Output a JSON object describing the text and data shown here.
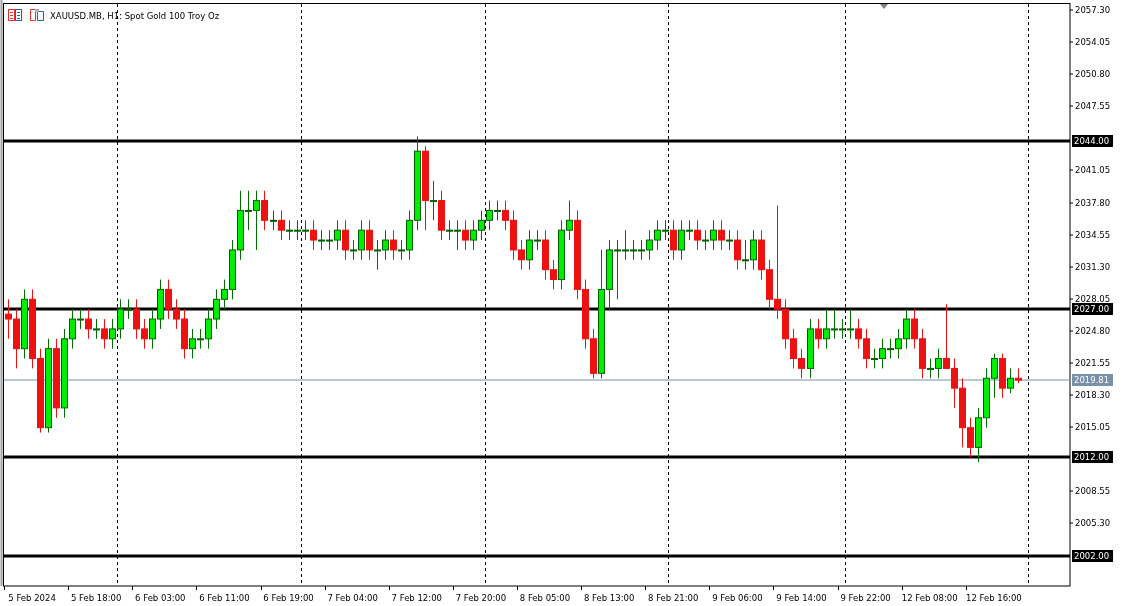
{
  "chart_title": {
    "symbol": "XAUUSD.MB, H1:",
    "description": "Spot Gold 100 Troy Oz"
  },
  "chart_data": {
    "type": "candlestick",
    "ylim": [
      1998.96,
      2057.91
    ],
    "categories": [
      null,
      null,
      null,
      "5 Feb 2024",
      null,
      null,
      null,
      null,
      null,
      null,
      null,
      "5 Feb 18:00",
      null,
      null,
      null,
      null,
      null,
      null,
      null,
      "6 Feb 03:00",
      null,
      null,
      null,
      null,
      null,
      null,
      null,
      "6 Feb 11:00",
      null,
      null,
      null,
      null,
      null,
      null,
      null,
      "6 Feb 19:00",
      null,
      null,
      null,
      null,
      null,
      null,
      null,
      "7 Feb 04:00",
      null,
      null,
      null,
      null,
      null,
      null,
      null,
      "7 Feb 12:00",
      null,
      null,
      null,
      null,
      null,
      null,
      null,
      "7 Feb 20:00",
      null,
      null,
      null,
      null,
      null,
      null,
      null,
      "8 Feb 05:00",
      null,
      null,
      null,
      null,
      null,
      null,
      null,
      "8 Feb 13:00",
      null,
      null,
      null,
      null,
      null,
      null,
      null,
      "8 Feb 21:00",
      null,
      null,
      null,
      null,
      null,
      null,
      null,
      "9 Feb 06:00",
      null,
      null,
      null,
      null,
      null,
      null,
      null,
      "9 Feb 14:00",
      null,
      null,
      null,
      null,
      null,
      null,
      null,
      "9 Feb 22:00",
      null,
      null,
      null,
      null,
      null,
      null,
      null,
      "12 Feb 08:00",
      null,
      null,
      null,
      null,
      null,
      null,
      null,
      "12 Feb 16:00",
      null,
      null,
      null,
      null,
      null,
      null,
      null,
      null,
      null
    ],
    "yticks": [
      {
        "value": 2057.3,
        "label": "2057.30"
      },
      {
        "value": 2054.05,
        "label": "2054.05"
      },
      {
        "value": 2050.8,
        "label": "2050.80"
      },
      {
        "value": 2047.55,
        "label": "2047.55"
      },
      {
        "value": 2041.05,
        "label": "2041.05"
      },
      {
        "value": 2037.8,
        "label": "2037.80"
      },
      {
        "value": 2034.55,
        "label": "2034.55"
      },
      {
        "value": 2031.3,
        "label": "2031.30"
      },
      {
        "value": 2028.05,
        "label": "2028.05"
      },
      {
        "value": 2024.8,
        "label": "2024.80"
      },
      {
        "value": 2021.55,
        "label": "2021.55"
      },
      {
        "value": 2018.3,
        "label": "2018.30"
      },
      {
        "value": 2015.05,
        "label": "2015.05"
      },
      {
        "value": 2008.55,
        "label": "2008.55"
      },
      {
        "value": 2005.3,
        "label": "2005.30"
      }
    ],
    "ref_lines": [
      {
        "axis": "y",
        "value": 2044.0,
        "label": "2044.00",
        "color": "#000000"
      },
      {
        "axis": "y",
        "value": 2027.0,
        "label": "2027.00",
        "color": "#000000"
      },
      {
        "axis": "y",
        "value": 2019.81,
        "label": "2019.81",
        "color": "#7890a8"
      },
      {
        "axis": "y",
        "value": 2012.0,
        "label": "2012.00",
        "color": "#000000"
      },
      {
        "axis": "y",
        "value": 2002.0,
        "label": "2002.00",
        "color": "#000000"
      }
    ],
    "ohlc": [
      [
        2026.5,
        2028,
        2024,
        2026
      ],
      [
        2026,
        2027,
        2021,
        2023
      ],
      [
        2023,
        2029,
        2022,
        2028
      ],
      [
        2028,
        2029,
        2021,
        2022
      ],
      [
        2022,
        2023,
        2014.5,
        2015
      ],
      [
        2015,
        2024,
        2014.5,
        2023
      ],
      [
        2023,
        2024,
        2016,
        2017
      ],
      [
        2017,
        2025,
        2016,
        2024
      ],
      [
        2024,
        2027,
        2023,
        2026
      ],
      [
        2026,
        2027,
        2025,
        2026
      ],
      [
        2026,
        2027,
        2024,
        2025
      ],
      [
        2025,
        2026,
        2024,
        2025
      ],
      [
        2025,
        2026,
        2023,
        2024
      ],
      [
        2024,
        2026,
        2023,
        2025
      ],
      [
        2025,
        2028,
        2024,
        2027
      ],
      [
        2027,
        2028,
        2026,
        2027
      ],
      [
        2027,
        2028,
        2024,
        2025
      ],
      [
        2025,
        2026,
        2023,
        2024
      ],
      [
        2024,
        2027,
        2023,
        2026
      ],
      [
        2026,
        2030,
        2025,
        2029
      ],
      [
        2029,
        2030,
        2026,
        2027
      ],
      [
        2027,
        2028,
        2025,
        2026
      ],
      [
        2026,
        2027,
        2022,
        2023
      ],
      [
        2023,
        2025,
        2022,
        2024
      ],
      [
        2024,
        2025,
        2023,
        2024
      ],
      [
        2024,
        2027,
        2023,
        2026
      ],
      [
        2026,
        2029,
        2025,
        2028
      ],
      [
        2028,
        2030,
        2027,
        2029
      ],
      [
        2029,
        2034,
        2028,
        2033
      ],
      [
        2033,
        2039,
        2032,
        2037
      ],
      [
        2037,
        2039,
        2035,
        2037
      ],
      [
        2037,
        2039,
        2033,
        2038
      ],
      [
        2038,
        2039,
        2035,
        2036
      ],
      [
        2036,
        2037,
        2035,
        2036
      ],
      [
        2036,
        2037,
        2034,
        2035
      ],
      [
        2035,
        2036,
        2034,
        2035
      ],
      [
        2035,
        2036,
        2034,
        2035
      ],
      [
        2035,
        2036,
        2034,
        2035
      ],
      [
        2035,
        2036,
        2033,
        2034
      ],
      [
        2034,
        2035,
        2033,
        2034
      ],
      [
        2034,
        2035,
        2033,
        2034
      ],
      [
        2034,
        2036,
        2033,
        2035
      ],
      [
        2035,
        2036,
        2032,
        2033
      ],
      [
        2033,
        2034,
        2032,
        2033
      ],
      [
        2033,
        2036,
        2032,
        2035
      ],
      [
        2035,
        2036,
        2032,
        2033
      ],
      [
        2033,
        2034,
        2031,
        2033
      ],
      [
        2033,
        2035,
        2032,
        2034
      ],
      [
        2034,
        2035,
        2032,
        2033
      ],
      [
        2033,
        2034,
        2032,
        2033
      ],
      [
        2033,
        2037,
        2032,
        2036
      ],
      [
        2036,
        2044.5,
        2035,
        2043
      ],
      [
        2043,
        2043.5,
        2035,
        2038
      ],
      [
        2038,
        2040,
        2036,
        2038
      ],
      [
        2038,
        2039,
        2034,
        2035
      ],
      [
        2035,
        2036,
        2034,
        2035
      ],
      [
        2035,
        2036,
        2033,
        2035
      ],
      [
        2035,
        2036,
        2033,
        2034
      ],
      [
        2034,
        2036,
        2033,
        2035
      ],
      [
        2035,
        2037,
        2034,
        2036
      ],
      [
        2036,
        2038,
        2035,
        2037
      ],
      [
        2037,
        2038,
        2036,
        2037
      ],
      [
        2037,
        2038,
        2035,
        2036
      ],
      [
        2036,
        2037,
        2032,
        2033
      ],
      [
        2033,
        2034,
        2031,
        2032
      ],
      [
        2032,
        2035,
        2031,
        2034
      ],
      [
        2034,
        2035,
        2033,
        2034
      ],
      [
        2034,
        2035,
        2030,
        2031
      ],
      [
        2031,
        2032,
        2029,
        2030
      ],
      [
        2030,
        2036,
        2029,
        2035
      ],
      [
        2035,
        2038,
        2034,
        2036
      ],
      [
        2036,
        2037,
        2028,
        2029
      ],
      [
        2029,
        2030,
        2023,
        2024
      ],
      [
        2024,
        2025,
        2020,
        2020.5
      ],
      [
        2020.5,
        2033,
        2020,
        2029
      ],
      [
        2029,
        2034,
        2027,
        2033
      ],
      [
        2033,
        2034,
        2028,
        2033
      ],
      [
        2033,
        2035,
        2032,
        2033
      ],
      [
        2033,
        2034,
        2032,
        2033
      ],
      [
        2033,
        2034,
        2032,
        2033
      ],
      [
        2033,
        2035,
        2032,
        2034
      ],
      [
        2034,
        2036,
        2033,
        2035
      ],
      [
        2035,
        2036,
        2034,
        2035
      ],
      [
        2035,
        2036,
        2032,
        2033
      ],
      [
        2033,
        2036,
        2032,
        2035
      ],
      [
        2035,
        2036,
        2034,
        2035
      ],
      [
        2035,
        2036,
        2033,
        2034
      ],
      [
        2034,
        2035,
        2033,
        2034
      ],
      [
        2034,
        2036,
        2033,
        2035
      ],
      [
        2035,
        2036,
        2033,
        2034
      ],
      [
        2034,
        2035,
        2033,
        2034
      ],
      [
        2034,
        2035,
        2031,
        2032
      ],
      [
        2032,
        2034,
        2031,
        2032
      ],
      [
        2032,
        2035,
        2031,
        2034
      ],
      [
        2034,
        2035,
        2030,
        2031
      ],
      [
        2031,
        2032,
        2027,
        2028
      ],
      [
        2028,
        2037.5,
        2026,
        2027
      ],
      [
        2027,
        2028,
        2023,
        2024
      ],
      [
        2024,
        2025,
        2021,
        2022
      ],
      [
        2022,
        2023,
        2020,
        2021
      ],
      [
        2021,
        2026,
        2020,
        2025
      ],
      [
        2025,
        2026,
        2023,
        2024
      ],
      [
        2024,
        2027,
        2023,
        2025
      ],
      [
        2025,
        2027,
        2024,
        2025
      ],
      [
        2025,
        2026,
        2024,
        2025
      ],
      [
        2025,
        2027,
        2024,
        2025
      ],
      [
        2025,
        2026,
        2023,
        2024
      ],
      [
        2024,
        2025,
        2021,
        2022
      ],
      [
        2022,
        2023,
        2021,
        2022
      ],
      [
        2022,
        2024,
        2021,
        2023
      ],
      [
        2023,
        2024,
        2022,
        2023
      ],
      [
        2023,
        2025,
        2022,
        2024
      ],
      [
        2024,
        2027,
        2023,
        2026
      ],
      [
        2026,
        2027,
        2023,
        2024
      ],
      [
        2024,
        2025,
        2020,
        2021
      ],
      [
        2021,
        2022,
        2020,
        2021
      ],
      [
        2021,
        2023,
        2020,
        2022
      ],
      [
        2022,
        2027.5,
        2021,
        2021
      ],
      [
        2021,
        2022,
        2017,
        2019
      ],
      [
        2019,
        2020,
        2013,
        2015
      ],
      [
        2015,
        2016,
        2012,
        2013
      ],
      [
        2013,
        2017,
        2011.5,
        2016
      ],
      [
        2016,
        2021,
        2015,
        2020
      ],
      [
        2020,
        2022.5,
        2018,
        2022
      ],
      [
        2022,
        2022.5,
        2018,
        2019
      ],
      [
        2019,
        2021,
        2018.5,
        2020
      ],
      [
        2020,
        2021,
        2019.5,
        2019.81
      ],
      null,
      null,
      null,
      null,
      null,
      null
    ]
  }
}
